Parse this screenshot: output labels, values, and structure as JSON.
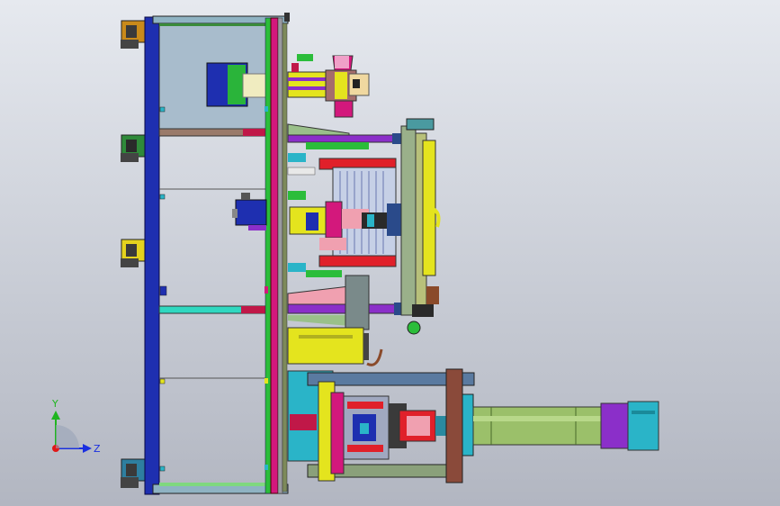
{
  "triad": {
    "y_label": "Y",
    "z_label": "Z",
    "y_color": "#1fb51f",
    "z_color": "#1a2fe0",
    "origin_color": "#e01818"
  },
  "palette": {
    "frame_blue": "#1e2fb0",
    "frame_magenta": "#d3187c",
    "panel_fill": "#a8bccc",
    "yellow": "#e4e41e",
    "green": "#2bbd3a",
    "cyan": "#29c9d3",
    "purple": "#8b2fc9",
    "red": "#e0202a",
    "olive": "#9bc06a",
    "brown": "#8a4a2a"
  }
}
